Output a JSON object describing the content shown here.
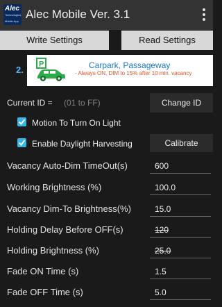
{
  "app": {
    "logo_text": "Alec",
    "logo_subtext": "Technologies",
    "logo_caption": "Mobile App",
    "title": "Alec Mobile Ver. 3.1"
  },
  "toolbar": {
    "write_label": "Write Settings",
    "read_label": "Read Settings"
  },
  "mode": {
    "number": "2.",
    "title": "Carpark, Passageway",
    "description": "- Always ON,  DIM to 15% after 10 min. vacancy",
    "icon": "parking-car-icon"
  },
  "current_id": {
    "label": "Current ID =",
    "placeholder": "(01 to FF)",
    "button_label": "Change ID"
  },
  "checkboxes": [
    {
      "label": "Motion To Turn On Light",
      "checked": true
    },
    {
      "label": "Enable Daylight Harvesting",
      "checked": true,
      "button_label": "Calibrate"
    }
  ],
  "settings": [
    {
      "label": "Vacancy Auto-Dim TimeOut(s)",
      "value": "600",
      "disabled": false
    },
    {
      "label": "Working Brightness (%)",
      "value": "100.0",
      "disabled": false
    },
    {
      "label": "Vacancy Dim-To Brightness(%)",
      "value": "15.0",
      "disabled": false
    },
    {
      "label": "Holding Delay Before OFF(s)",
      "value": "120",
      "disabled": true
    },
    {
      "label": "Holding Brightness (%)",
      "value": "25.0",
      "disabled": true
    },
    {
      "label": "Fade ON Time (s)",
      "value": "1.5",
      "disabled": false
    },
    {
      "label": "Fade OFF Time (s)",
      "value": "5.0",
      "disabled": false
    }
  ],
  "colors": {
    "appbar": "#333333",
    "background": "#1a1a1a",
    "accent": "#33b5e5",
    "mode_title": "#1976d2",
    "mode_desc": "#e0542a",
    "parking_green": "#2bab4a"
  }
}
